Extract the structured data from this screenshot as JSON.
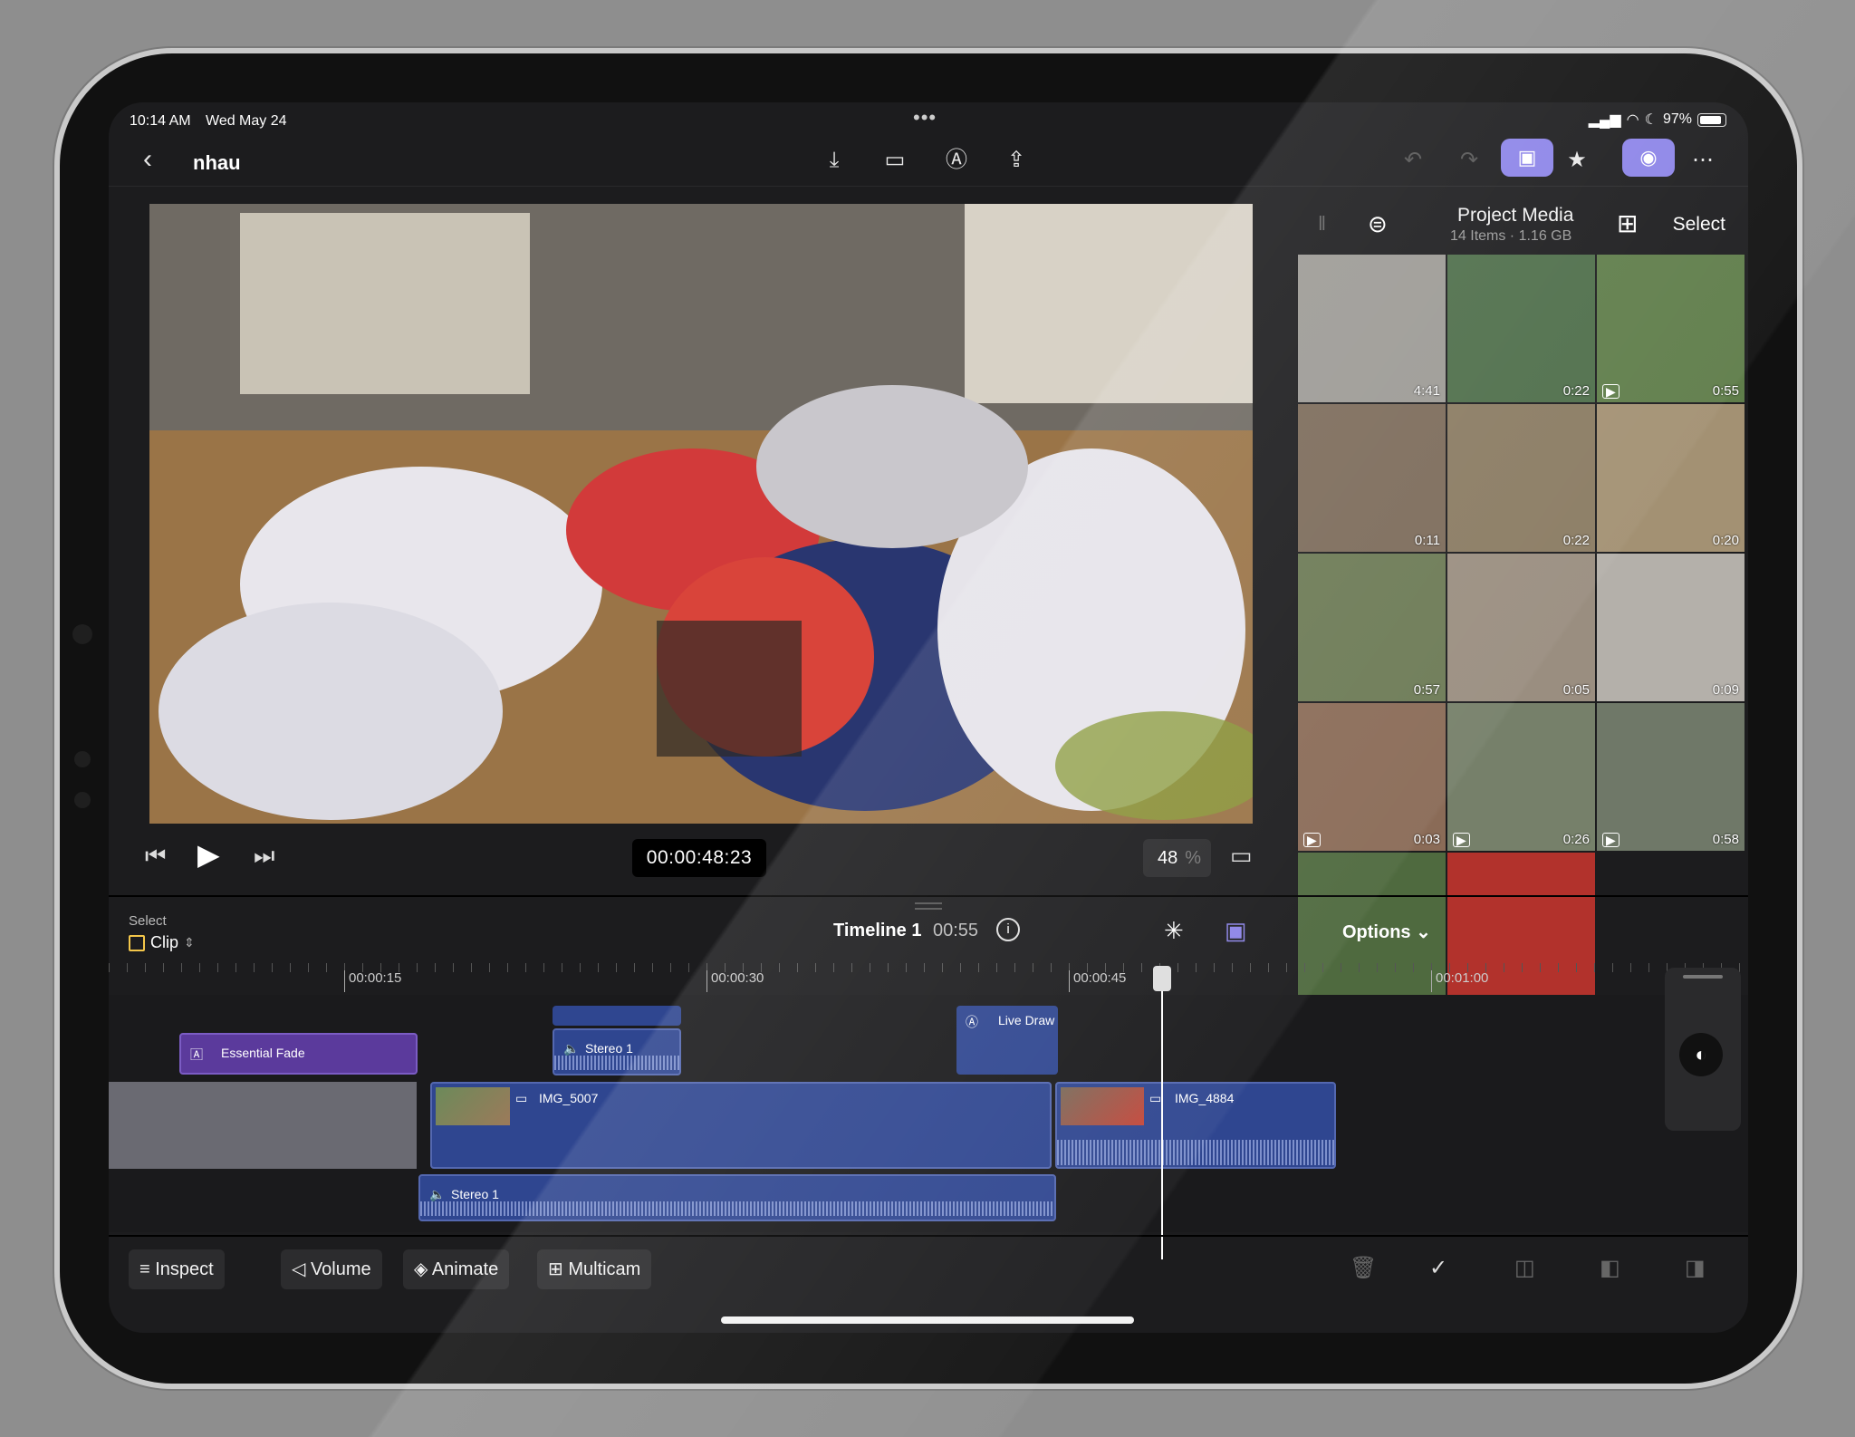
{
  "status": {
    "time": "10:14 AM",
    "date": "Wed May 24",
    "battery": "97%"
  },
  "nav": {
    "title": "nhau"
  },
  "viewer": {
    "timecode": "00:00:48:23",
    "zoom": "48",
    "zoom_unit": "%"
  },
  "browser": {
    "title": "Project Media",
    "subtitle": "14 Items  ·  1.16 GB",
    "select_label": "Select",
    "thumbs": [
      {
        "duration": "4:41",
        "video": false,
        "color": "#9c9a95"
      },
      {
        "duration": "0:22",
        "video": false,
        "color": "#4e6e4a"
      },
      {
        "duration": "0:55",
        "video": true,
        "color": "#5f7d4a"
      },
      {
        "duration": "0:11",
        "video": false,
        "color": "#7c6b5a"
      },
      {
        "duration": "0:22",
        "video": false,
        "color": "#8a7b62"
      },
      {
        "duration": "0:20",
        "video": false,
        "color": "#a39173"
      },
      {
        "duration": "0:57",
        "video": false,
        "color": "#6c7a55"
      },
      {
        "duration": "0:05",
        "video": false,
        "color": "#9a8e80"
      },
      {
        "duration": "0:09",
        "video": false,
        "color": "#b4b0aa"
      },
      {
        "duration": "0:03",
        "video": true,
        "color": "#8a6b57"
      },
      {
        "duration": "0:26",
        "video": true,
        "color": "#76806a"
      },
      {
        "duration": "0:58",
        "video": true,
        "color": "#6f7868"
      }
    ]
  },
  "timeline": {
    "select_label": "Select",
    "mode": "Clip",
    "title": "Timeline 1",
    "duration": "00:55",
    "options_label": "Options",
    "ruler": [
      "00:00:15",
      "00:00:30",
      "00:00:45",
      "00:01:00"
    ],
    "clips": {
      "essential_fade": "Essential Fade",
      "stereo_top": "Stereo 1",
      "live_draw": "Live Draw",
      "img_5007": "IMG_5007",
      "img_4884": "IMG_4884",
      "stereo_bottom": "Stereo 1"
    }
  },
  "toolbar": {
    "inspect": "Inspect",
    "volume": "Volume",
    "animate": "Animate",
    "multicam": "Multicam"
  }
}
